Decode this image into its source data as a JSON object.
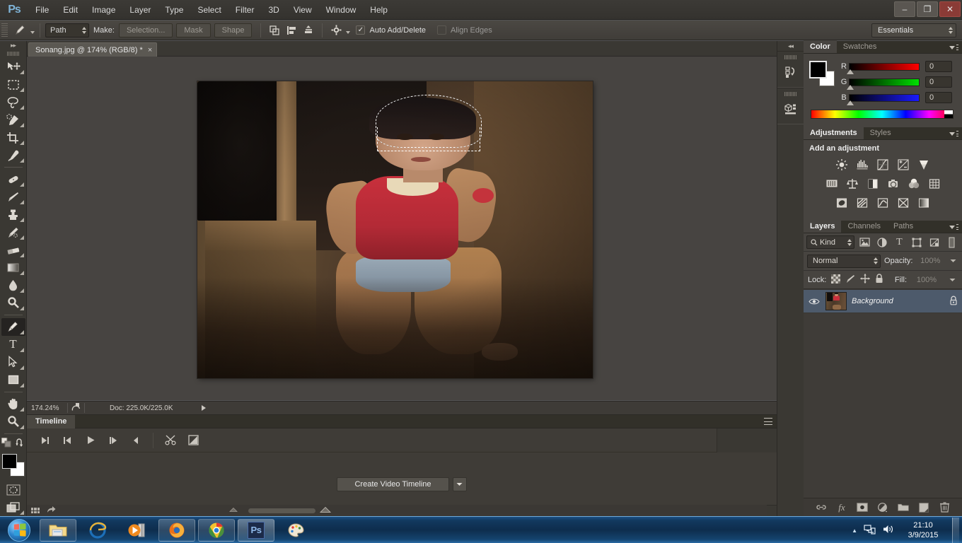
{
  "app": {
    "name": "Adobe Photoshop",
    "logo": "Ps"
  },
  "menubar": {
    "items": [
      {
        "label": "File"
      },
      {
        "label": "Edit"
      },
      {
        "label": "Image"
      },
      {
        "label": "Layer"
      },
      {
        "label": "Type"
      },
      {
        "label": "Select"
      },
      {
        "label": "Filter"
      },
      {
        "label": "3D"
      },
      {
        "label": "View"
      },
      {
        "label": "Window"
      },
      {
        "label": "Help"
      }
    ],
    "window_controls": {
      "minimize": "–",
      "restore": "❐",
      "close": "✕"
    }
  },
  "options_bar": {
    "tool_icon": "pen-tool-icon",
    "mode_value": "Path",
    "make_label": "Make:",
    "make_buttons": [
      "Selection...",
      "Mask",
      "Shape"
    ],
    "path_ops": [
      "path-operations-icon",
      "path-alignment-icon",
      "path-arrangement-icon"
    ],
    "gear_icon": "gear-icon",
    "auto_add_delete": {
      "label": "Auto Add/Delete",
      "checked": true,
      "mark": "✓"
    },
    "align_edges": {
      "label": "Align Edges",
      "checked": false
    },
    "workspace": "Essentials"
  },
  "document": {
    "tab_title": "Sonang.jpg @ 174% (RGB/8) *",
    "close_glyph": "×",
    "file_name": "Sonang.jpg",
    "zoom_label": "174%",
    "color_mode": "RGB/8",
    "modified": true
  },
  "toolbar": {
    "collapse_glyph": "▸▸",
    "tools": [
      {
        "name": "move-tool",
        "glyph": "✣"
      },
      {
        "name": "rectangular-marquee-tool",
        "glyph": "⬚"
      },
      {
        "name": "lasso-tool",
        "glyph": "Ⱏ"
      },
      {
        "name": "quick-selection-tool",
        "glyph": "✎"
      },
      {
        "name": "crop-tool",
        "glyph": "⛶"
      },
      {
        "name": "eyedropper-tool",
        "glyph": "✒"
      },
      {
        "name": "spot-healing-brush-tool",
        "glyph": "❁"
      },
      {
        "name": "brush-tool",
        "glyph": "✏"
      },
      {
        "name": "clone-stamp-tool",
        "glyph": "⬤"
      },
      {
        "name": "history-brush-tool",
        "glyph": "✐"
      },
      {
        "name": "eraser-tool",
        "glyph": "▱"
      },
      {
        "name": "gradient-tool",
        "glyph": "■"
      },
      {
        "name": "blur-tool",
        "glyph": "●"
      },
      {
        "name": "dodge-tool",
        "glyph": "⚲"
      },
      {
        "name": "pen-tool",
        "glyph": "✒",
        "active": true
      },
      {
        "name": "type-tool",
        "glyph": "T"
      },
      {
        "name": "path-selection-tool",
        "glyph": "➤"
      },
      {
        "name": "rectangle-tool",
        "glyph": "■"
      },
      {
        "name": "hand-tool",
        "glyph": "✋"
      },
      {
        "name": "zoom-tool",
        "glyph": "⚲"
      }
    ],
    "extras": {
      "default_colors": "default-colors-icon",
      "swap_colors": "swap-colors-icon",
      "foreground_color": "#000000",
      "background_color": "#ffffff",
      "quick_mask": "quick-mask-icon",
      "screen_mode": "screen-mode-icon"
    }
  },
  "status_bar": {
    "zoom": "174.24%",
    "doc_icon": "document-thumb-icon",
    "doc_info": "Doc: 225.0K/225.0K",
    "arrow": "▶"
  },
  "timeline": {
    "tab_label": "Timeline",
    "menu_icon": "panel-menu-icon",
    "controls": [
      {
        "name": "go-to-first-frame-button",
        "glyph": "▶|"
      },
      {
        "name": "previous-frame-button",
        "glyph": "◀|"
      },
      {
        "name": "play-button",
        "glyph": "▶"
      },
      {
        "name": "next-frame-button",
        "glyph": "|▶"
      },
      {
        "name": "audio-button",
        "glyph": "◀"
      },
      {
        "name": "split-at-playhead-button",
        "glyph": "✂"
      },
      {
        "name": "transition-button",
        "glyph": "◤"
      }
    ],
    "create_button": "Create Video Timeline",
    "create_dropdown_glyph": "▾",
    "footer_icons": [
      "grid-view-icon",
      "share-icon"
    ]
  },
  "icon_dock": {
    "collapse_glyph": "◂◂",
    "items": [
      {
        "name": "history-panel-icon"
      },
      {
        "name": "3d-panel-icon"
      }
    ]
  },
  "color_panel": {
    "tabs": [
      {
        "label": "Color",
        "active": true
      },
      {
        "label": "Swatches",
        "active": false
      }
    ],
    "menu_icon": "panel-menu-icon",
    "foreground": "#000000",
    "background": "#ffffff",
    "channels": [
      {
        "letter": "R",
        "value": "0"
      },
      {
        "letter": "G",
        "value": "0"
      },
      {
        "letter": "B",
        "value": "0"
      }
    ]
  },
  "adjustments_panel": {
    "tabs": [
      {
        "label": "Adjustments",
        "active": true
      },
      {
        "label": "Styles",
        "active": false
      }
    ],
    "menu_icon": "panel-menu-icon",
    "title": "Add an adjustment",
    "rows": [
      [
        {
          "name": "brightness-contrast-icon",
          "glyph": "☼"
        },
        {
          "name": "levels-icon",
          "glyph": "☰"
        },
        {
          "name": "curves-icon",
          "glyph": "↗"
        },
        {
          "name": "exposure-icon",
          "glyph": "±"
        },
        {
          "name": "vibrance-icon",
          "glyph": "▽"
        }
      ],
      [
        {
          "name": "hue-saturation-icon",
          "glyph": "▒"
        },
        {
          "name": "color-balance-icon",
          "glyph": "⚖"
        },
        {
          "name": "black-and-white-icon",
          "glyph": "◑"
        },
        {
          "name": "photo-filter-icon",
          "glyph": "◎"
        },
        {
          "name": "channel-mixer-icon",
          "glyph": "⬤"
        },
        {
          "name": "color-lookup-icon",
          "glyph": "⊞"
        }
      ],
      [
        {
          "name": "invert-icon",
          "glyph": "◐"
        },
        {
          "name": "posterize-icon",
          "glyph": "▧"
        },
        {
          "name": "threshold-icon",
          "glyph": "⤳"
        },
        {
          "name": "selective-color-icon",
          "glyph": "⌧"
        },
        {
          "name": "gradient-map-icon",
          "glyph": "▤"
        }
      ]
    ]
  },
  "layers_panel": {
    "tabs": [
      {
        "label": "Layers",
        "active": true
      },
      {
        "label": "Channels",
        "active": false
      },
      {
        "label": "Paths",
        "active": false
      }
    ],
    "menu_icon": "panel-menu-icon",
    "filter_kind": "Kind",
    "filter_icons": [
      {
        "name": "filter-pixel-layers-icon",
        "glyph": "⛰"
      },
      {
        "name": "filter-adjustment-layers-icon",
        "glyph": "◑"
      },
      {
        "name": "filter-type-layers-icon",
        "glyph": "T"
      },
      {
        "name": "filter-shape-layers-icon",
        "glyph": "⬚"
      },
      {
        "name": "filter-smart-objects-icon",
        "glyph": "◰"
      },
      {
        "name": "filter-toggle-icon",
        "glyph": "▮"
      }
    ],
    "blend_mode": "Normal",
    "opacity_label": "Opacity:",
    "opacity_value": "100%",
    "lock_label": "Lock:",
    "lock_icons": [
      {
        "name": "lock-transparent-pixels-icon",
        "glyph": "▦"
      },
      {
        "name": "lock-image-pixels-icon",
        "glyph": "✎"
      },
      {
        "name": "lock-position-icon",
        "glyph": "✣"
      },
      {
        "name": "lock-all-icon",
        "glyph": "■"
      }
    ],
    "fill_label": "Fill:",
    "fill_value": "100%",
    "layers": [
      {
        "name": "Background",
        "visible": true,
        "locked": true,
        "selected": true,
        "eye_glyph": "◉",
        "lock_glyph": "■"
      }
    ],
    "footer_icons": [
      {
        "name": "link-layers-icon",
        "glyph": "⚭"
      },
      {
        "name": "layer-style-icon",
        "glyph": "fx"
      },
      {
        "name": "add-layer-mask-icon",
        "glyph": "▣"
      },
      {
        "name": "new-adjustment-layer-icon",
        "glyph": "◑"
      },
      {
        "name": "new-group-icon",
        "glyph": "▰"
      },
      {
        "name": "new-layer-icon",
        "glyph": "◱"
      },
      {
        "name": "delete-layer-icon",
        "glyph": "⌧"
      }
    ]
  },
  "taskbar": {
    "start_label": "Start",
    "apps": [
      {
        "name": "windows-explorer-taskbar-icon",
        "label": "Windows Explorer"
      },
      {
        "name": "internet-explorer-taskbar-icon",
        "label": "Internet Explorer"
      },
      {
        "name": "windows-media-player-taskbar-icon",
        "label": "Windows Media Player"
      },
      {
        "name": "firefox-taskbar-icon",
        "label": "Mozilla Firefox"
      },
      {
        "name": "google-chrome-taskbar-icon",
        "label": "Google Chrome"
      },
      {
        "name": "photoshop-taskbar-icon",
        "label": "Adobe Photoshop",
        "glyph": "Ps"
      },
      {
        "name": "paint-taskbar-icon",
        "label": "Paint"
      }
    ],
    "tray": {
      "show_hidden_glyph": "▲",
      "network_icon": "network-icon",
      "volume_icon": "volume-icon",
      "time": "21:10",
      "date": "3/9/2015"
    }
  }
}
